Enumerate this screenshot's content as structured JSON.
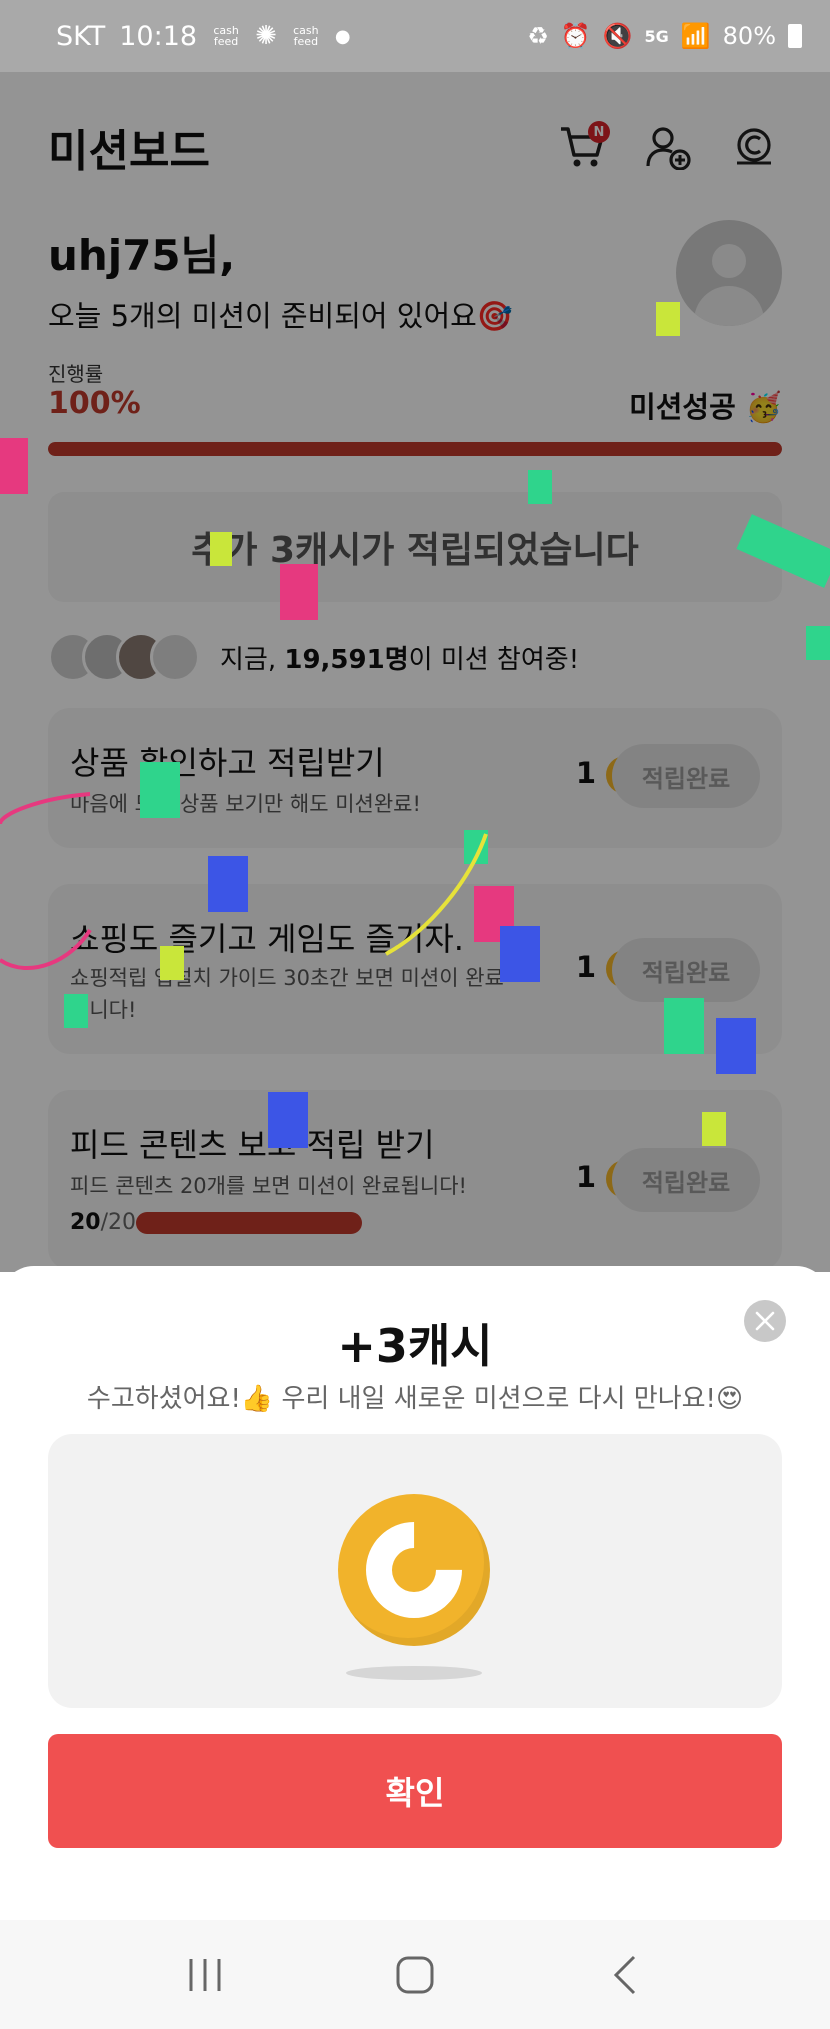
{
  "status_bar": {
    "carrier": "SKT",
    "time": "10:18",
    "notif1": "cash feed",
    "notif2": "cash feed",
    "network": "5G",
    "battery": "80%"
  },
  "header": {
    "title": "미션보드",
    "cart_badge": "N"
  },
  "greeting": {
    "user_name": "uhj75님,",
    "mission_count": "오늘 5개의 미션이 준비되어 있어요🎯"
  },
  "progress": {
    "label": "진행률",
    "value": "100%",
    "fraction": 1.0,
    "success_label": "미션성공 🥳"
  },
  "reward_banner": {
    "text": "추가 3캐시가 적립되었습니다"
  },
  "participants": {
    "prefix": "지금, ",
    "count": "19,591명",
    "suffix": "이 미션 참여중!"
  },
  "missions": [
    {
      "title": "상품 확인하고 적립받기",
      "desc": "마음에 드는 상품 보기만 해도 미션완료!",
      "reward": "1",
      "button": "적립완료"
    },
    {
      "title": "쇼핑도 즐기고 게임도 즐기자.",
      "desc": "쇼핑적립 앱설치 가이드 30초간 보면 미션이 완료됩니다!",
      "reward": "1",
      "button": "적립완료"
    },
    {
      "title": "피드 콘텐츠 보고 적립 받기",
      "desc": "피드 콘텐츠 20개를 보면 미션이 완료됩니다!",
      "reward": "1",
      "button": "적립완료",
      "count_done": "20",
      "count_total": "/20",
      "progress": 1.0
    }
  ],
  "sheet": {
    "title": "+3캐시",
    "subtitle": "수고하셨어요!👍 우리 내일 새로운 미션으로 다시 만나요!😍",
    "confirm": "확인"
  },
  "colors": {
    "accent": "#f05050",
    "coin": "#f1b32b",
    "progress": "#c0392b"
  }
}
